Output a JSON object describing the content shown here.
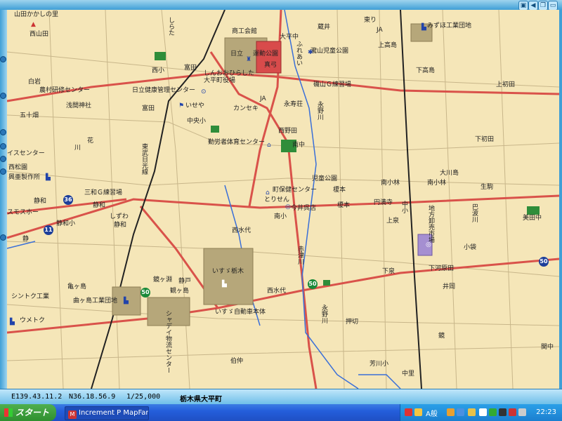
{
  "window": {
    "controls": [
      "▣",
      "◀",
      "❐",
      "▭",
      "✕"
    ]
  },
  "route_labels": {
    "r36": "36",
    "r11": "11",
    "r50a": "50",
    "r50b": "50"
  },
  "map_labels": {
    "yamada_kakashi": "山田かかしの里",
    "nishiyamada": "西山田",
    "shirota": "しらた",
    "shokokaikan": "商工会館",
    "ohirachu": "大平中",
    "kurai": "蔵井",
    "higashi_ri": "東り",
    "ja_top": "JA",
    "mizuho": "みずほ工業団地",
    "kamitakashima": "上高島",
    "hitachi": "日立",
    "undokoen": "運動公園",
    "tatsuyama_jido": "瀧山児童公園",
    "nishisho": "西小",
    "tomita1": "富田",
    "shinohira": "しんおおひらした",
    "ohira_yakuba": "大平町役場",
    "makikaminoyama": "真弓",
    "fureai": "ふれあい",
    "shimotakashima": "下高島",
    "kamihatsuta": "上初田",
    "shiroi": "白岩",
    "nouson": "農村研修センター",
    "kenko": "日立健康管理センター",
    "tatsuyama_g": "磯山Ｇ練習場",
    "asami": "浅間神社",
    "isesaki": "いせや",
    "kansei": "カンセキ",
    "ja_mid": "JA",
    "eijuso": "永寿荘",
    "nagano_r_top": "永野川",
    "tomita2": "富田",
    "gojisshi": "五十畑",
    "chuosho": "中央小",
    "nishinoda": "西野田",
    "kinro": "勤労者体育センター",
    "minamichu": "南中",
    "shimohatsuta": "下初田",
    "kawa": "川",
    "hana": "花",
    "higashi_muko": "東武日光線",
    "isu_center": "イスセンター",
    "nishimatsu": "西松園",
    "kosei": "興亜製作所",
    "jido_koen": "児童公園",
    "minamikobayashi": "南小林",
    "oogawashima": "大川島",
    "seikatsu": "生駒",
    "sanwa": "三和Ｇ練習場",
    "machi_hoken": "町保健センター",
    "enoki": "榎本",
    "minamikobayashi2": "南小林",
    "shinwa1": "静和",
    "sumosu": "スモスホー",
    "shinwa2": "静和",
    "torisen": "とりせん",
    "imaicho": "今井呉店",
    "enoki2": "榎本",
    "enshin": "円満寺",
    "nakasho": "中小",
    "chiho": "地方卸売市場",
    "ohanoya": "巴波川",
    "jitoda": "美田中",
    "shinwasho": "静和小",
    "shizuwa": "しずわ",
    "shinwa3": "静和",
    "nishimizushiro": "西水代",
    "minamisho": "南小",
    "kamiizumi": "上泉",
    "shizu": "静",
    "akatsukawa": "赤津川",
    "kobukuro": "小袋",
    "isuzu_tochigi": "いすゞ栃木",
    "shimoizumi": "下泉",
    "shimokawarada": "下河原田",
    "shintoku": "シントク工業",
    "kamegashima": "亀ヶ島",
    "kamegafuchi": "鏡ヶ淵",
    "shizudo": "静戸",
    "kanagashima2": "観ヶ島",
    "nishimizushiro2": "西水代",
    "iide": "井岡",
    "kamegashima_kogyo": "曲ヶ島工業団地",
    "isuzu_jidosha": "いすゞ自動車本体",
    "shaden": "シャデイ物流センター",
    "nagano_r_bot": "永野川",
    "oshikiri": "押切",
    "kagami": "鏡",
    "umetoku": "ウメトク",
    "sekishita": "関中",
    "hakuban": "伯仲",
    "tsugawa": "芳川小",
    "nakari": "中里"
  },
  "status_bar": {
    "longitude": "E139.43.11.2",
    "latitude": "N36.18.56.9",
    "scale": "1/25,000",
    "place": "栃木県大平町"
  },
  "taskbar": {
    "start_label": "スタート",
    "task_label": "Increment P MapFan...",
    "ime_label": "A般",
    "clock": "22:23"
  },
  "colors": {
    "map_background": "#f5e6b8",
    "road_red": "#d9524a",
    "road_minor": "#c8b68a",
    "river": "#3a6fd8",
    "railway": "#222222",
    "facility_tan": "#b6a77a",
    "facility_red": "#d84b4b",
    "park_green": "#2f8d3a",
    "market_purple": "#a58fd1"
  }
}
